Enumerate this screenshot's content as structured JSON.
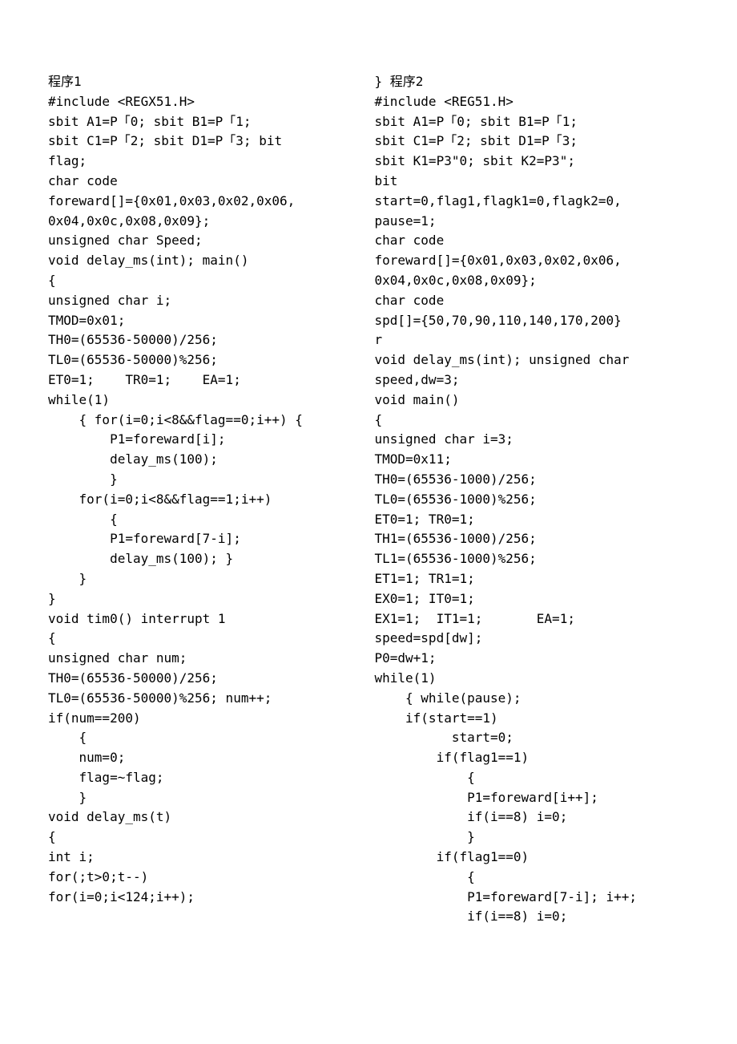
{
  "left": "程序1\n#include <REGX51.H>\nsbit A1=P「0; sbit B1=P「1;\nsbit C1=P「2; sbit D1=P「3; bit\nflag;\nchar code\nforeward[]={0x01,0x03,0x02,0x06,\n0x04,0x0c,0x08,0x09};\nunsigned char Speed;\nvoid delay_ms(int); main()\n{\nunsigned char i;\nTMOD=0x01;\nTH0=(65536-50000)/256;\nTL0=(65536-50000)%256;\nET0=1;    TR0=1;    EA=1;\nwhile(1)\n    { for(i=0;i<8&&flag==0;i++) {\n        P1=foreward[i];\n        delay_ms(100);\n        }\n    for(i=0;i<8&&flag==1;i++)\n        {\n        P1=foreward[7-i];\n        delay_ms(100); }\n    }\n}\nvoid tim0() interrupt 1\n{\nunsigned char num;\nTH0=(65536-50000)/256;\nTL0=(65536-50000)%256; num++;\nif(num==200)\n    {\n    num=0;\n    flag=~flag;\n    }\nvoid delay_ms(t)\n{\nint i;\nfor(;t>0;t--)\nfor(i=0;i<124;i++);",
  "right": "} 程序2\n#include <REG51.H>\nsbit A1=P「0; sbit B1=P「1;\nsbit C1=P「2; sbit D1=P「3;\nsbit K1=P3\"0; sbit K2=P3\";\nbit\nstart=0,flag1,flagk1=0,flagk2=0,\npause=1;\nchar code\nforeward[]={0x01,0x03,0x02,0x06,\n0x04,0x0c,0x08,0x09};\nchar code\nspd[]={50,70,90,110,140,170,200}\nr\nvoid delay_ms(int); unsigned char\nspeed,dw=3;\nvoid main()\n{\nunsigned char i=3;\nTMOD=0x11;\nTH0=(65536-1000)/256;\nTL0=(65536-1000)%256;\nET0=1; TR0=1;\nTH1=(65536-1000)/256;\nTL1=(65536-1000)%256;\nET1=1; TR1=1;\nEX0=1; IT0=1;\nEX1=1;  IT1=1;       EA=1;\nspeed=spd[dw];\nP0=dw+1;\nwhile(1)\n    { while(pause);\n    if(start==1)\n          start=0;\n        if(flag1==1)\n            {\n            P1=foreward[i++];\n            if(i==8) i=0;\n            }\n        if(flag1==0)\n            {\n            P1=foreward[7-i]; i++;\n            if(i==8) i=0;"
}
